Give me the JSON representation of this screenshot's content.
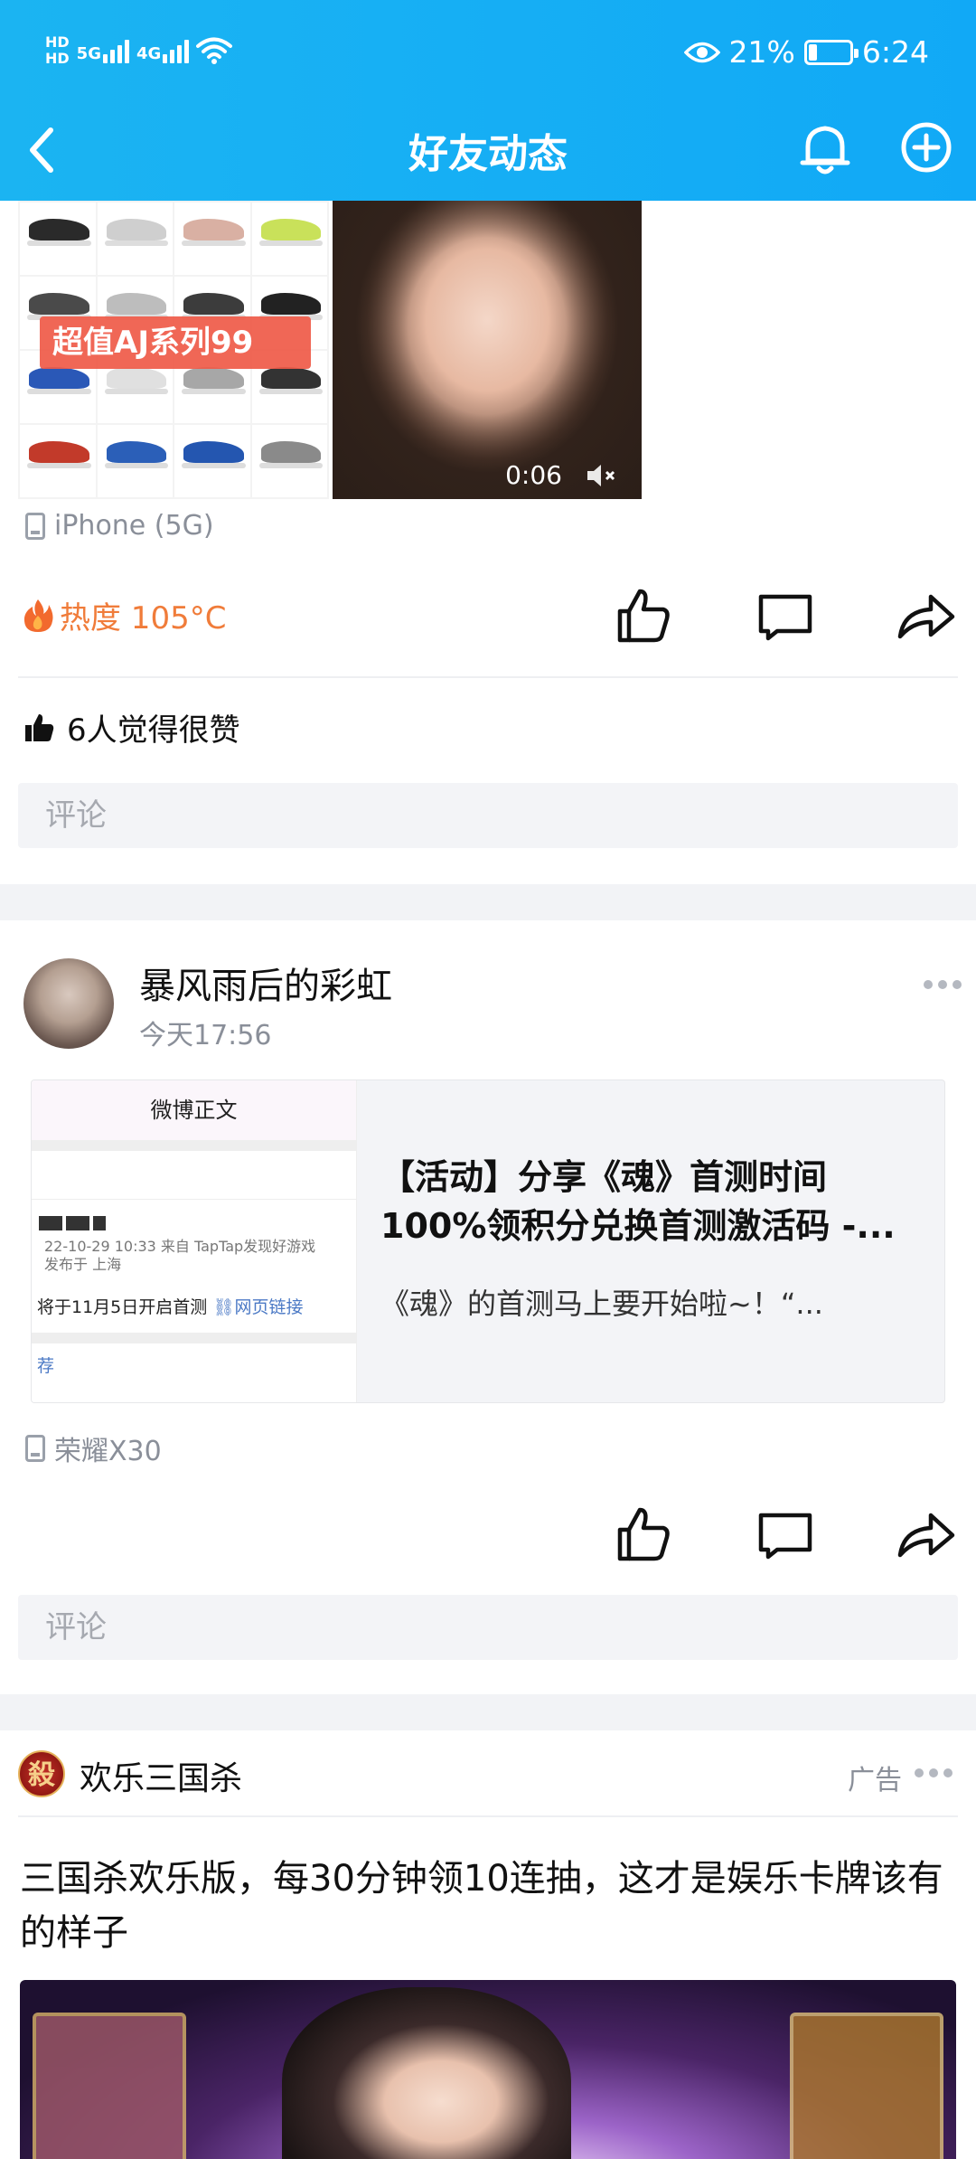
{
  "status_bar": {
    "hd1": "HD",
    "hd2": "HD",
    "net1": "5G",
    "net2": "4G",
    "battery_text": "21%",
    "battery_level": 0.21,
    "time": "6:24"
  },
  "nav": {
    "title": "好友动态"
  },
  "post1": {
    "shoe_banner": "超值AJ系列99",
    "video_duration": "0:06",
    "device": "iPhone (5G)",
    "heat": "热度 105°C",
    "likes_text": "6人觉得很赞",
    "comment_placeholder": "评论"
  },
  "post2": {
    "username": "暴风雨后的彩虹",
    "time": "今天17:56",
    "link_card": {
      "thumb_header": "微博正文",
      "thumb_meta1": "22-10-29 10:33  来自 TapTap发现好游戏",
      "thumb_meta2": "发布于 上海",
      "thumb_body": "将于11月5日开启首测",
      "thumb_link": "网页链接",
      "thumb_tag": "荐",
      "title_line1": "【活动】分享《魂》首测时间",
      "title_line2": "100%领积分兑换首测激活码 -...",
      "desc": "《魂》的首测马上要开始啦~！“..."
    },
    "device": "荣耀X30",
    "comment_placeholder": "评论"
  },
  "ad": {
    "logo_char": "殺",
    "name": "欢乐三国杀",
    "tag": "广告",
    "text": "三国杀欢乐版，每30分钟领10连抽，这才是娱乐卡牌该有的样子"
  },
  "colors": {
    "header": "#14aef4",
    "heat": "#f07c3a",
    "muted": "#8a8f99"
  }
}
